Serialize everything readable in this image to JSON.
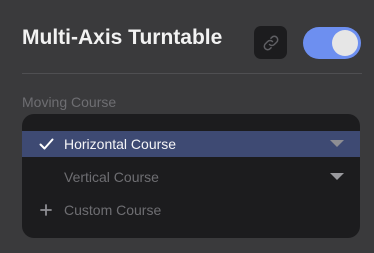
{
  "header": {
    "title": "Multi-Axis Turntable",
    "link_icon": "link-icon",
    "toggle_on": true
  },
  "moving_course": {
    "label": "Moving Course",
    "items": [
      {
        "label": "Horizontal Course",
        "selected": true,
        "icon": "checkmark-icon",
        "expandable": true
      },
      {
        "label": "Vertical Course",
        "selected": false,
        "icon": "",
        "expandable": true
      },
      {
        "label": "Custom Course",
        "selected": false,
        "icon": "plus-icon",
        "expandable": false
      }
    ]
  },
  "colors": {
    "background": "#3a3a3c",
    "list_background": "#1c1c1e",
    "selected_row": "#3e4a73",
    "accent": "#6d8ff0"
  }
}
